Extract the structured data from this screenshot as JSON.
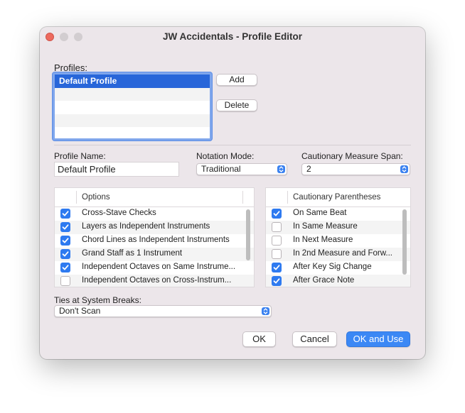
{
  "window": {
    "title": "JW Accidentals - Profile Editor"
  },
  "profiles": {
    "label": "Profiles:",
    "items": [
      "Default Profile",
      "",
      "",
      "",
      ""
    ],
    "add_label": "Add",
    "delete_label": "Delete"
  },
  "profile_name": {
    "label": "Profile Name:",
    "value": "Default Profile"
  },
  "notation_mode": {
    "label": "Notation Mode:",
    "value": "Traditional"
  },
  "cautionary_span": {
    "label": "Cautionary Measure Span:",
    "value": "2"
  },
  "options_table": {
    "header": "Options",
    "rows": [
      {
        "label": "Cross-Stave Checks",
        "checked": true
      },
      {
        "label": "Layers as Independent Instruments",
        "checked": true
      },
      {
        "label": "Chord Lines as Independent Instruments",
        "checked": true
      },
      {
        "label": "Grand Staff as 1 Instrument",
        "checked": true
      },
      {
        "label": "Independent Octaves on Same Instrume...",
        "checked": true
      },
      {
        "label": "Independent Octaves on Cross-Instrum...",
        "checked": false
      }
    ]
  },
  "parentheses_table": {
    "header": "Cautionary Parentheses",
    "rows": [
      {
        "label": "On Same Beat",
        "checked": true
      },
      {
        "label": "In Same Measure",
        "checked": false
      },
      {
        "label": "In Next Measure",
        "checked": false
      },
      {
        "label": "In 2nd Measure and Forw...",
        "checked": false
      },
      {
        "label": "After Key Sig Change",
        "checked": true
      },
      {
        "label": "After Grace Note",
        "checked": true
      }
    ]
  },
  "ties": {
    "label": "Ties at System Breaks:",
    "value": "Don't Scan"
  },
  "buttons": {
    "ok": "OK",
    "cancel": "Cancel",
    "ok_use": "OK and Use"
  },
  "colors": {
    "accent": "#3b88f5",
    "selection": "#2866d9",
    "close": "#ed6a5e"
  }
}
